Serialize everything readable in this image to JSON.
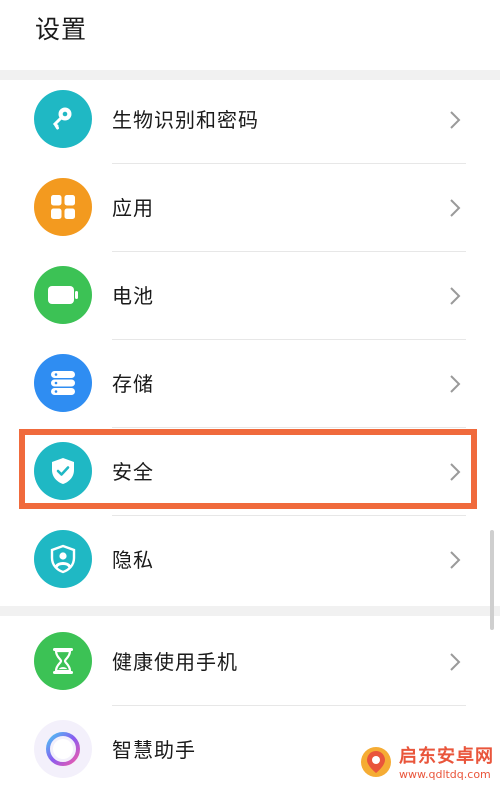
{
  "header": {
    "title": "设置"
  },
  "items": [
    {
      "label": "生物识别和密码",
      "icon": "key-icon",
      "color": "#1fb8c4"
    },
    {
      "label": "应用",
      "icon": "apps-grid-icon",
      "color": "#f39a1f"
    },
    {
      "label": "电池",
      "icon": "battery-icon",
      "color": "#3cc255"
    },
    {
      "label": "存储",
      "icon": "storage-icon",
      "color": "#2f8df2"
    },
    {
      "label": "安全",
      "icon": "shield-check-icon",
      "color": "#1fb8c4"
    },
    {
      "label": "隐私",
      "icon": "privacy-shield-icon",
      "color": "#1fb8c4"
    },
    {
      "label": "健康使用手机",
      "icon": "hourglass-icon",
      "color": "#3cc255"
    },
    {
      "label": "智慧助手",
      "icon": "assistant-orb-icon",
      "color": "#7a6cf0"
    }
  ],
  "watermark": {
    "main": "启东安卓网",
    "sub": "www.qdltdq.com"
  },
  "colors": {
    "highlight": "#f06a3c",
    "separator": "#f1f1f1"
  }
}
